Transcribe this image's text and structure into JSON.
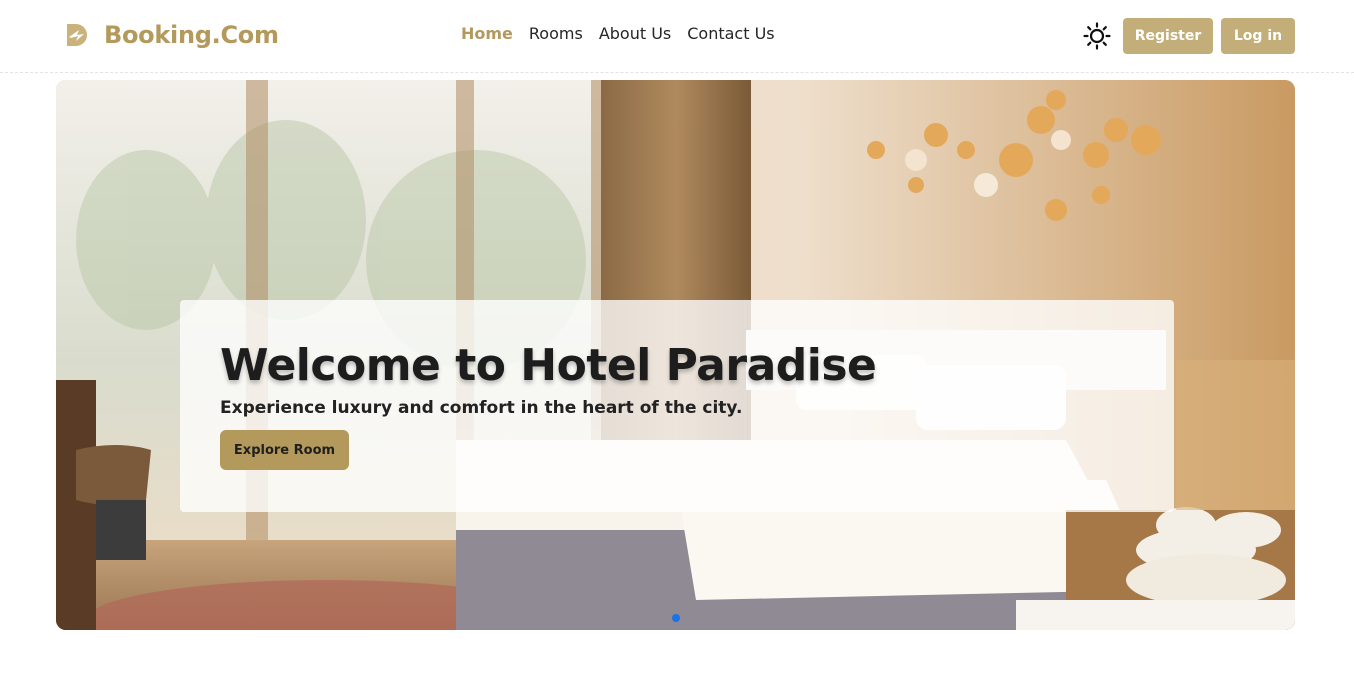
{
  "header": {
    "brand_name": "Booking.Com",
    "nav": [
      {
        "label": "Home",
        "active": true
      },
      {
        "label": "Rooms",
        "active": false
      },
      {
        "label": "About Us",
        "active": false
      },
      {
        "label": "Contact Us",
        "active": false
      }
    ],
    "theme_icon": "sun-icon",
    "register_label": "Register",
    "login_label": "Log in"
  },
  "hero": {
    "title": "Welcome to Hotel Paradise",
    "subtitle": "Experience luxury and comfort in the heart of the city.",
    "cta_label": "Explore Room",
    "slide_count": 1,
    "active_slide": 1
  },
  "colors": {
    "brand": "#b39a5c",
    "button": "#c3ae7a",
    "active_dot": "#1a73e8"
  }
}
